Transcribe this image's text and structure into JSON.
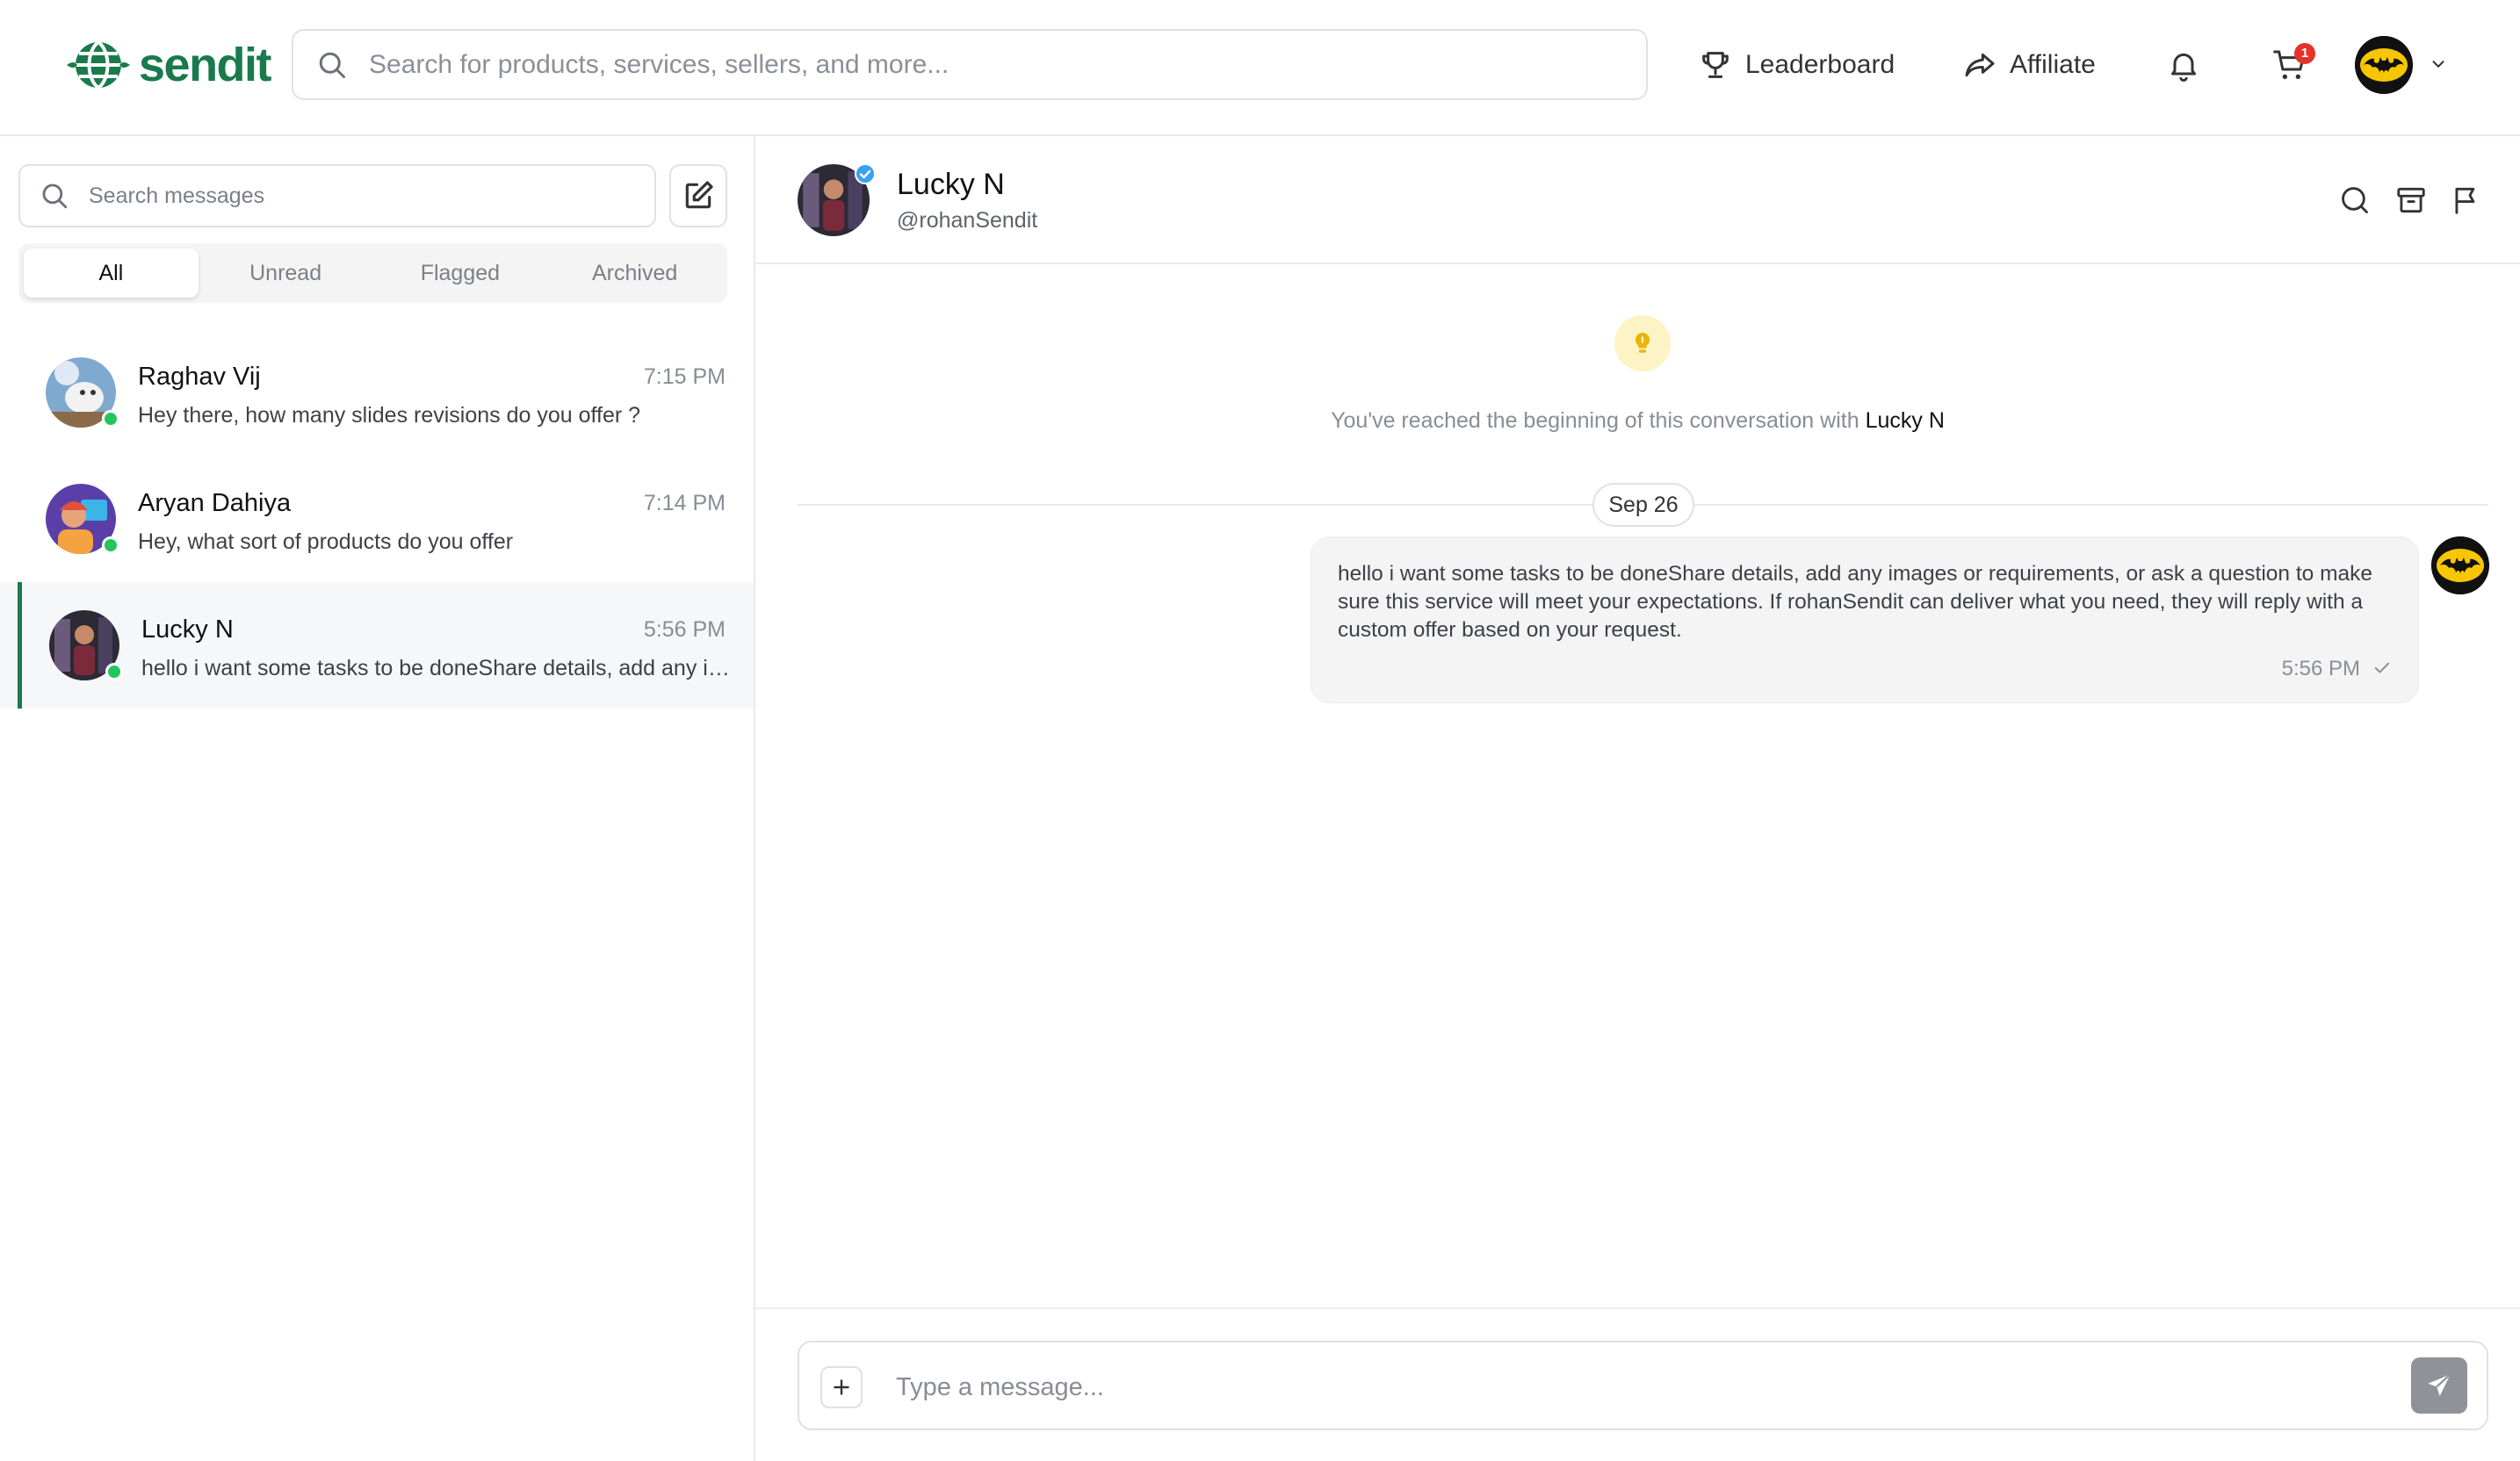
{
  "header": {
    "logo_text": "sendit",
    "search_placeholder": "Search for products, services, sellers, and more...",
    "nav": {
      "leaderboard": "Leaderboard",
      "affiliate": "Affiliate"
    },
    "cart_badge": "1",
    "brand_color": "#1a7a4c"
  },
  "sidebar": {
    "search_placeholder": "Search messages",
    "tabs": [
      "All",
      "Unread",
      "Flagged",
      "Archived"
    ],
    "active_tab": "All",
    "conversations": [
      {
        "name": "Raghav Vij",
        "time": "7:15 PM",
        "preview": "Hey there, how many slides revisions do you offer ?",
        "online": true
      },
      {
        "name": "Aryan Dahiya",
        "time": "7:14 PM",
        "preview": "Hey, what sort of products do you offer",
        "online": true
      },
      {
        "name": "Lucky N",
        "time": "5:56 PM",
        "preview": "hello i want some tasks to be doneShare details, add any images or requirements, or ask a question to make sure this service will meet your expectations.",
        "online": true,
        "selected": true
      }
    ]
  },
  "chat": {
    "name": "Lucky N",
    "handle": "@rohanSendit",
    "intro_prefix": "You've reached the beginning of this conversation with ",
    "intro_name": "Lucky N",
    "date_divider": "Sep 26",
    "messages": [
      {
        "text": "hello i want some tasks to be doneShare details, add any images or requirements, or ask a question to make sure this service will meet your expectations. If rohanSendit can deliver what you need, they will reply with a custom offer based on your request.",
        "time": "5:56 PM",
        "status": "sent"
      }
    ],
    "composer_placeholder": "Type a message..."
  }
}
